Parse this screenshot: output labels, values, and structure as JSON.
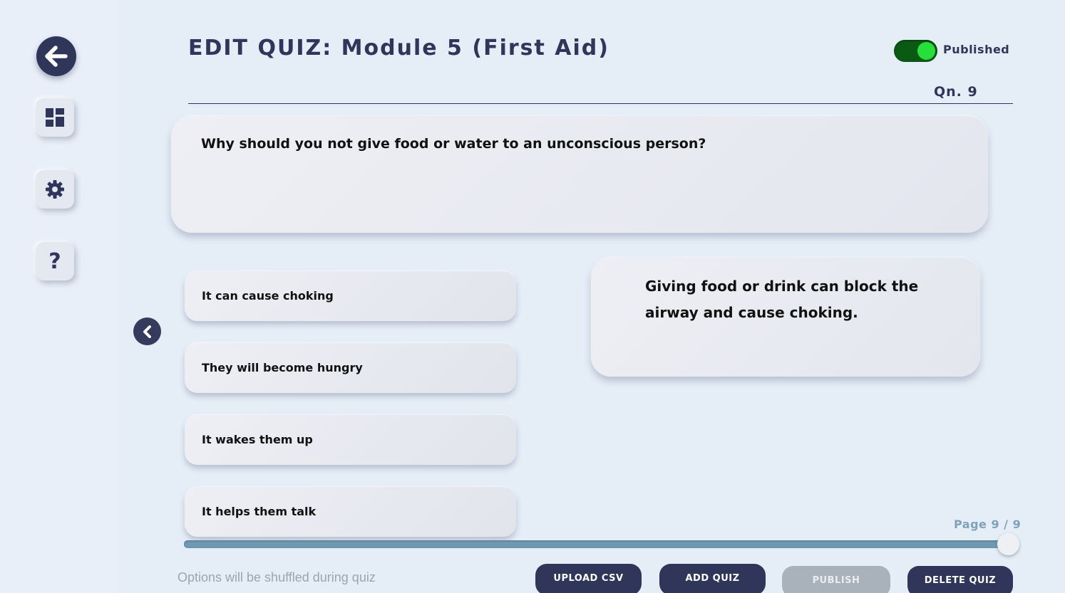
{
  "header": {
    "title": "EDIT QUIZ: Module 5 (First Aid)",
    "status_label": "Published",
    "status_on": true,
    "question_number": "Qn. 9"
  },
  "sidebar": {
    "back_icon": "arrow-left-icon",
    "items": [
      {
        "icon": "dashboard-grid-icon"
      },
      {
        "icon": "gear-icon"
      },
      {
        "icon": "help-icon",
        "glyph": "?"
      }
    ]
  },
  "question": {
    "text": "Why should you not give food or water to an unconscious person?"
  },
  "options": [
    {
      "text": "It can cause choking"
    },
    {
      "text": "They will become hungry"
    },
    {
      "text": "It wakes them up"
    },
    {
      "text": "It helps them talk"
    }
  ],
  "explanation": {
    "text": "Giving food or drink can block the airway and cause choking."
  },
  "pagination": {
    "label": "Page 9 / 9",
    "current": 9,
    "total": 9,
    "progress": 1.0
  },
  "footer": {
    "note": "Options will be shuffled during quiz",
    "buttons": {
      "upload_csv": "UPLOAD CSV",
      "add_quiz": "ADD QUIZ",
      "publish": "PUBLISH",
      "delete_quiz": "DELETE QUIZ"
    }
  },
  "colors": {
    "background": "#e5edf7",
    "navy": "#2f3659",
    "toggle_on": "#27df3a",
    "slider": "#6f98b3",
    "disabled": "#a9b1ba"
  }
}
